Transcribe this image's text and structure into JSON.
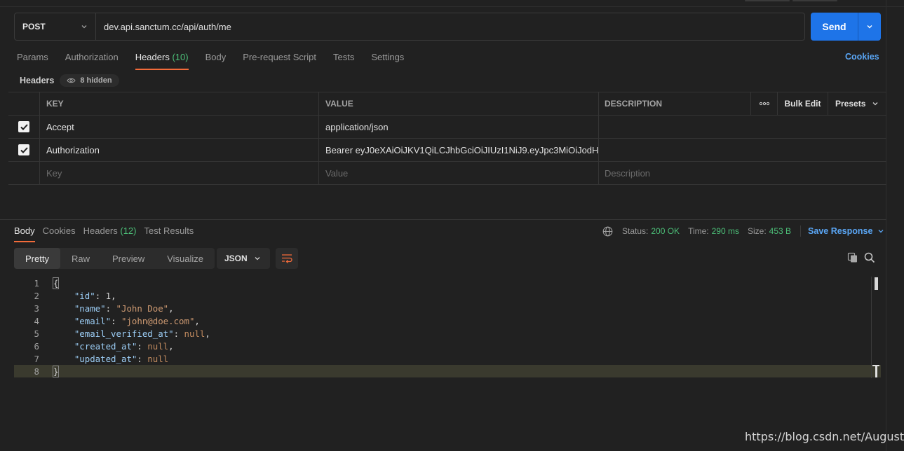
{
  "request": {
    "method": "POST",
    "url": "dev.api.sanctum.cc/api/auth/me",
    "send_label": "Send"
  },
  "request_tabs": [
    {
      "label": "Params",
      "count": ""
    },
    {
      "label": "Authorization",
      "count": ""
    },
    {
      "label": "Headers",
      "count": "(10)",
      "active": true
    },
    {
      "label": "Body",
      "count": ""
    },
    {
      "label": "Pre-request Script",
      "count": ""
    },
    {
      "label": "Tests",
      "count": ""
    },
    {
      "label": "Settings",
      "count": ""
    }
  ],
  "cookies_link": "Cookies",
  "headers_section": {
    "title": "Headers",
    "hidden_label": "8 hidden"
  },
  "headers_table": {
    "columns": {
      "key": "KEY",
      "value": "VALUE",
      "description": "DESCRIPTION",
      "more": "∘∘∘",
      "bulk_edit": "Bulk Edit",
      "presets": "Presets"
    },
    "rows": [
      {
        "checked": true,
        "key": "Accept",
        "value": "application/json",
        "description": ""
      },
      {
        "checked": true,
        "key": "Authorization",
        "value": "Bearer eyJ0eXAiOiJKV1QiLCJhbGciOiJIUzI1NiJ9.eyJpc3MiOiJodH...",
        "description": ""
      }
    ],
    "placeholders": {
      "key": "Key",
      "value": "Value",
      "description": "Description"
    }
  },
  "response_tabs": [
    {
      "label": "Body",
      "count": "",
      "active": true
    },
    {
      "label": "Cookies",
      "count": ""
    },
    {
      "label": "Headers",
      "count": "(12)"
    },
    {
      "label": "Test Results",
      "count": ""
    }
  ],
  "response_status": {
    "status_label": "Status:",
    "status_value": "200 OK",
    "time_label": "Time:",
    "time_value": "290 ms",
    "size_label": "Size:",
    "size_value": "453 B",
    "save_response": "Save Response"
  },
  "view_modes": [
    "Pretty",
    "Raw",
    "Preview",
    "Visualize"
  ],
  "active_view": "Pretty",
  "format": "JSON",
  "code_lines": [
    {
      "n": "1",
      "html": "{"
    },
    {
      "n": "2",
      "html": "    \"id\": 1,"
    },
    {
      "n": "3",
      "html": "    \"name\": \"John Doe\","
    },
    {
      "n": "4",
      "html": "    \"email\": \"john@doe.com\","
    },
    {
      "n": "5",
      "html": "    \"email_verified_at\": null,"
    },
    {
      "n": "6",
      "html": "    \"created_at\": null,"
    },
    {
      "n": "7",
      "html": "    \"updated_at\": null"
    },
    {
      "n": "8",
      "html": "}"
    }
  ],
  "watermark": "https://blog.csdn.net/AugustDY",
  "colors": {
    "accent_blue": "#1e74e8",
    "link_blue": "#5aa6f5",
    "tab_underline": "#f26b3a",
    "success_green": "#4cbf78"
  }
}
